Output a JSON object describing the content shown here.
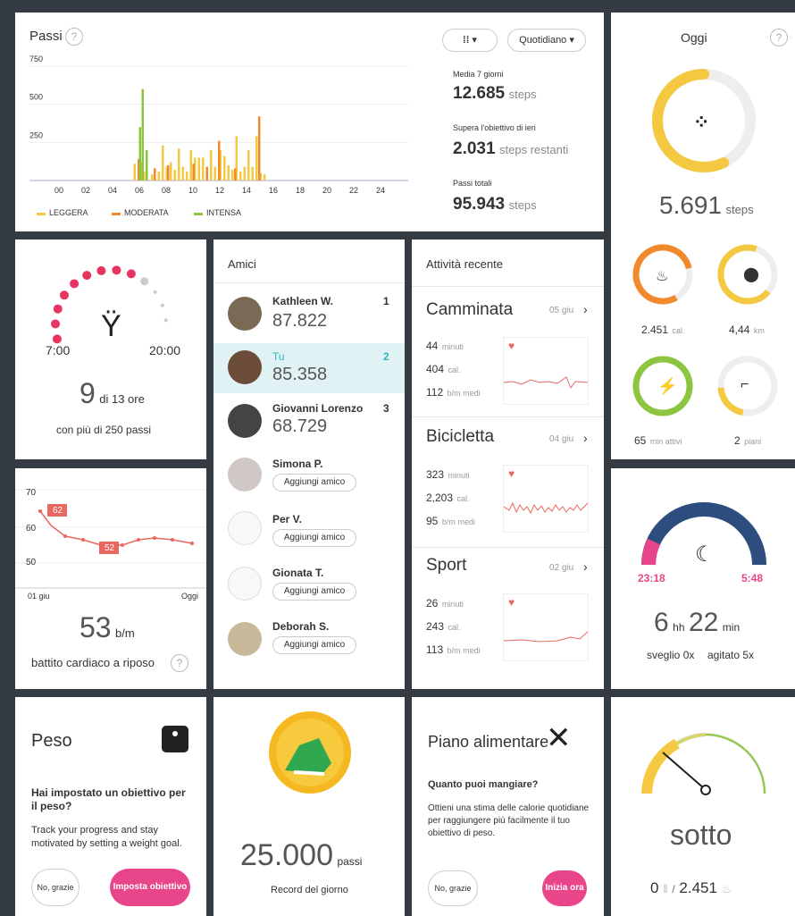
{
  "steps": {
    "title": "Passi",
    "help": "?",
    "filter_icon_label": "▾",
    "period_label": "Quotidiano",
    "avg_label": "Media 7 giorni",
    "avg_value": "12.685",
    "avg_unit": "steps",
    "goal_label": "Supera l'obiettivo di ieri",
    "goal_value": "2.031",
    "goal_unit": "steps restanti",
    "total_label": "Passi totali",
    "total_value": "95.943",
    "total_unit": "steps",
    "legend": [
      {
        "label": "LEGGERA",
        "color": "#f5c842"
      },
      {
        "label": "MODERATA",
        "color": "#f08a2c"
      },
      {
        "label": "INTENSA",
        "color": "#8cc63f"
      }
    ]
  },
  "chart_data": {
    "type": "bar",
    "title": "Passi",
    "x": [
      "00",
      "02",
      "04",
      "06",
      "08",
      "10",
      "12",
      "14",
      "16",
      "18",
      "20",
      "22",
      "24"
    ],
    "ylim": [
      0,
      750
    ],
    "yticks": [
      "750",
      "500",
      "250"
    ],
    "series": [
      {
        "name": "LEGGERA",
        "values": [
          [
            5.5,
            110
          ],
          [
            6.0,
            120
          ],
          [
            6.2,
            60
          ],
          [
            6.8,
            40
          ],
          [
            7.3,
            60
          ],
          [
            7.6,
            230
          ],
          [
            7.9,
            90
          ],
          [
            8.2,
            120
          ],
          [
            8.5,
            70
          ],
          [
            8.8,
            210
          ],
          [
            9.1,
            90
          ],
          [
            9.4,
            60
          ],
          [
            9.7,
            200
          ],
          [
            10.0,
            150
          ],
          [
            10.3,
            150
          ],
          [
            10.6,
            150
          ],
          [
            11.2,
            200
          ],
          [
            11.5,
            90
          ],
          [
            11.9,
            200
          ],
          [
            12.2,
            160
          ],
          [
            12.5,
            100
          ],
          [
            12.8,
            70
          ],
          [
            13.1,
            290
          ],
          [
            13.4,
            60
          ],
          [
            13.7,
            90
          ],
          [
            14.0,
            200
          ],
          [
            14.3,
            90
          ],
          [
            14.6,
            290
          ],
          [
            14.9,
            50
          ],
          [
            15.2,
            40
          ]
        ]
      },
      {
        "name": "MODERATA",
        "values": [
          [
            5.8,
            140
          ],
          [
            7.0,
            80
          ],
          [
            8.0,
            100
          ],
          [
            9.9,
            110
          ],
          [
            10.9,
            90
          ],
          [
            11.8,
            260
          ],
          [
            13.0,
            80
          ],
          [
            14.8,
            420
          ]
        ]
      },
      {
        "name": "INTENSA",
        "values": [
          [
            5.9,
            350
          ],
          [
            6.1,
            600
          ],
          [
            6.4,
            200
          ]
        ]
      }
    ]
  },
  "today": {
    "title": "Oggi",
    "help": "?",
    "steps_value": "5.691",
    "steps_unit": "steps",
    "steps_progress": 0.57,
    "calories_value": "2.451",
    "calories_unit": "cal.",
    "distance_value": "4,44",
    "distance_unit": "km",
    "active_value": "65",
    "active_unit": "min attivi",
    "floors_value": "2",
    "floors_unit": "piani",
    "colors": {
      "steps": "#f5c842",
      "calories": "#f08a2c",
      "distance": "#f5c842",
      "active": "#8cc63f",
      "floors": "#f5c842"
    }
  },
  "hourly": {
    "start": "7:00",
    "end": "20:00",
    "value": "9",
    "of_label": "di 13 ore",
    "caption": "con più di 250 passi",
    "active_hours": 9,
    "total_hours": 13
  },
  "heart": {
    "yticks": [
      "70",
      "60",
      "50"
    ],
    "x_start": "01 giu",
    "x_end": "Oggi",
    "label_high": "62",
    "label_low": "52",
    "value": "53",
    "unit": "b/m",
    "caption": "battito cardiaco a riposo",
    "help": "?"
  },
  "friends": {
    "title": "Amici",
    "add_label": "Aggiungi amico",
    "list": [
      {
        "name": "Kathleen W.",
        "steps": "87.822",
        "rank": "1"
      },
      {
        "name": "Tu",
        "steps": "85.358",
        "rank": "2"
      },
      {
        "name": "Giovanni Lorenzo",
        "steps": "68.729",
        "rank": "3"
      },
      {
        "name": "Simona P."
      },
      {
        "name": "Per V."
      },
      {
        "name": "Gionata T."
      },
      {
        "name": "Deborah S."
      }
    ]
  },
  "recent": {
    "title": "Attività recente",
    "items": [
      {
        "name": "Camminata",
        "date": "05 giu",
        "minutes": "44",
        "minutes_unit": "minuti",
        "cal": "404",
        "cal_unit": "cal.",
        "bpm": "112",
        "bpm_unit": "b/m medi"
      },
      {
        "name": "Bicicletta",
        "date": "04 giu",
        "minutes": "323",
        "minutes_unit": "minuti",
        "cal": "2,203",
        "cal_unit": "cal.",
        "bpm": "95",
        "bpm_unit": "b/m medi"
      },
      {
        "name": "Sport",
        "date": "02 giu",
        "minutes": "26",
        "minutes_unit": "minuti",
        "cal": "243",
        "cal_unit": "cal.",
        "bpm": "113",
        "bpm_unit": "b/m medi"
      }
    ]
  },
  "sleep": {
    "start": "23:18",
    "end": "5:48",
    "hours": "6",
    "hours_unit": "hh",
    "minutes": "22",
    "minutes_unit": "min",
    "awake": "sveglio 0x",
    "restless": "agitato 5x"
  },
  "weight": {
    "title": "Peso",
    "question": "Hai impostato un obiettivo per il peso?",
    "body": "Track your progress and stay motivated by setting a weight goal.",
    "no_label": "No, grazie",
    "set_label": "Imposta obiettivo"
  },
  "record": {
    "value": "25.000",
    "unit": "passi",
    "caption": "Record del giorno"
  },
  "food": {
    "title": "Piano alimentare",
    "question": "Quanto puoi mangiare?",
    "body": "Ottieni una stima delle calorie quotidiane per raggiungere più facilmente il tuo obiettivo di peso.",
    "no_label": "No, grazie",
    "start_label": "Inizia ora"
  },
  "balance": {
    "label": "sotto",
    "eaten": "0",
    "sep": "/",
    "burned": "2.451"
  }
}
